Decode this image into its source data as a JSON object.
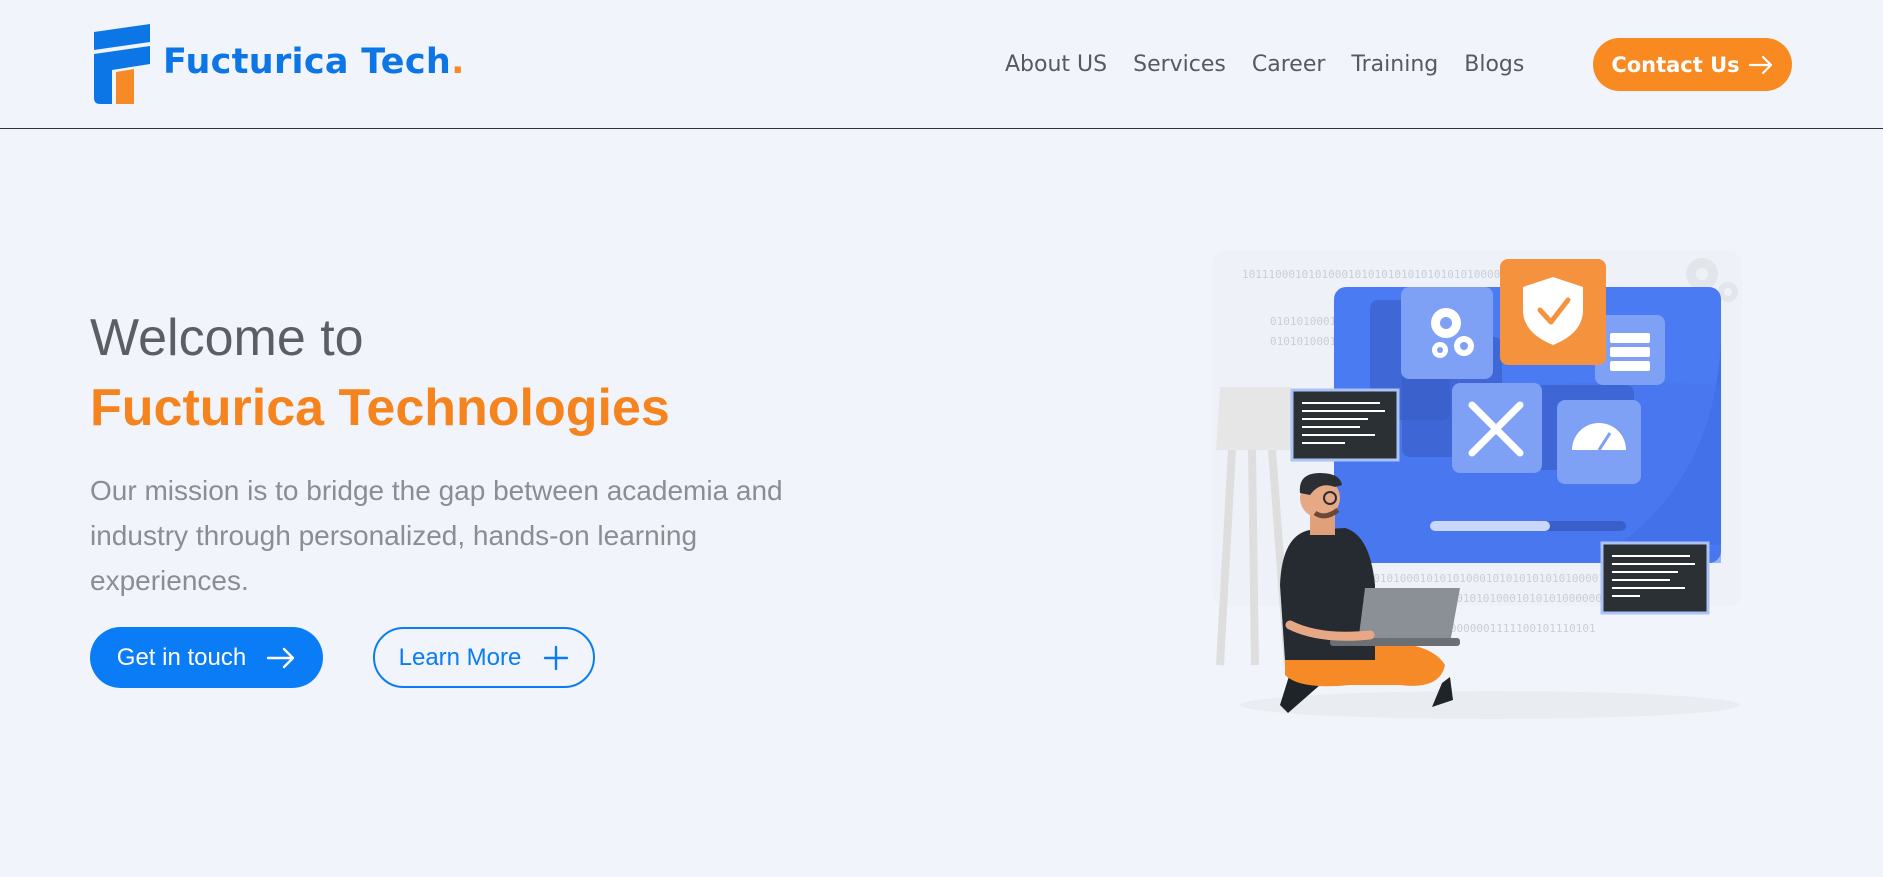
{
  "header": {
    "brand_text": "Fucturica Tech",
    "brand_dot": ".",
    "logo_icon": "fucturica-logo",
    "nav": [
      {
        "label": "About US"
      },
      {
        "label": "Services"
      },
      {
        "label": "Career"
      },
      {
        "label": "Training"
      },
      {
        "label": "Blogs"
      }
    ],
    "contact_label": "Contact Us",
    "contact_icon": "arrow-right-icon"
  },
  "hero": {
    "line1": "Welcome to",
    "line2": "Fucturica Technologies",
    "mission": "Our mission is to bridge the gap between academia and industry through personalized, hands-on learning experiences.",
    "primary_label": "Get in touch",
    "primary_icon": "arrow-right-icon",
    "secondary_label": "Learn More",
    "secondary_icon": "plus-icon",
    "illustration_binary": [
      "1011100010101000101010101010101010100000001111",
      "01010100010",
      "01010100010",
      "01010100010101010001010101010101000011101010100001",
      "010101000101010100010101010000001",
      "1000000001111100101110101"
    ]
  },
  "colors": {
    "brand_blue": "#0d76e6",
    "brand_orange": "#f58a26",
    "background": "#f1f5fb",
    "primary_button": "#0a7cf5",
    "contact_button": "#f98a22"
  }
}
